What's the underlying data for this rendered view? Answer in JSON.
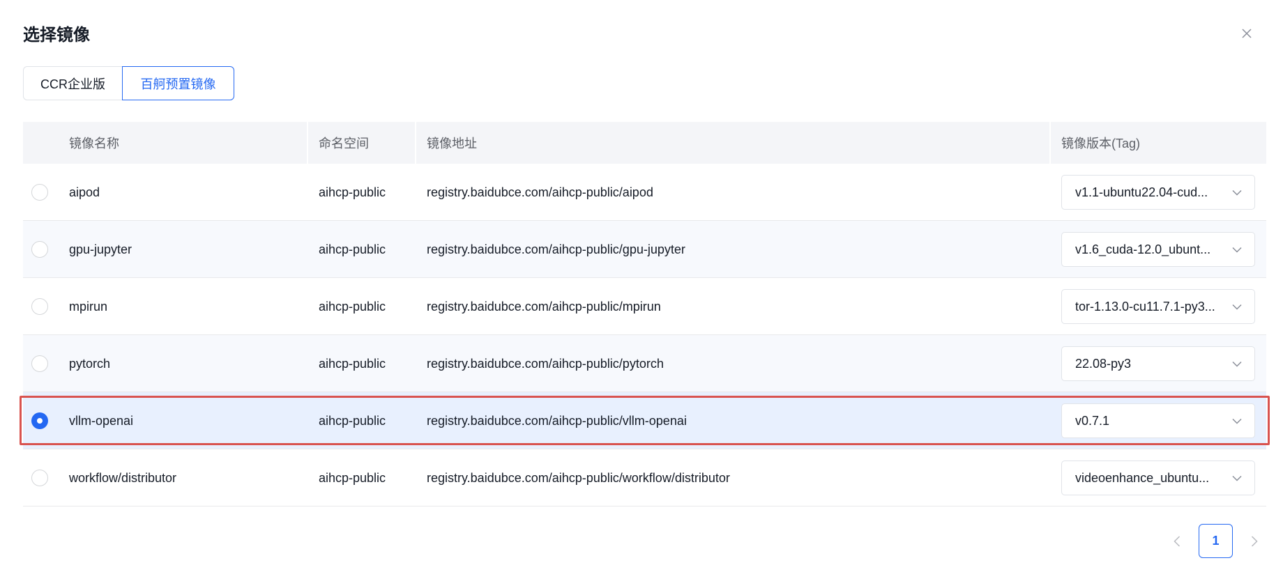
{
  "dialog": {
    "title": "选择镜像",
    "close_icon": "close-icon"
  },
  "tabs": [
    {
      "label": "CCR企业版",
      "active": false
    },
    {
      "label": "百舸预置镜像",
      "active": true
    }
  ],
  "table": {
    "columns": {
      "name": "镜像名称",
      "namespace": "命名空间",
      "address": "镜像地址",
      "tag": "镜像版本(Tag)"
    },
    "rows": [
      {
        "name": "aipod",
        "namespace": "aihcp-public",
        "address": "registry.baidubce.com/aihcp-public/aipod",
        "tag": "v1.1-ubuntu22.04-cud...",
        "selected": false
      },
      {
        "name": "gpu-jupyter",
        "namespace": "aihcp-public",
        "address": "registry.baidubce.com/aihcp-public/gpu-jupyter",
        "tag": "v1.6_cuda-12.0_ubunt...",
        "selected": false
      },
      {
        "name": "mpirun",
        "namespace": "aihcp-public",
        "address": "registry.baidubce.com/aihcp-public/mpirun",
        "tag": "tor-1.13.0-cu11.7.1-py3...",
        "selected": false
      },
      {
        "name": "pytorch",
        "namespace": "aihcp-public",
        "address": "registry.baidubce.com/aihcp-public/pytorch",
        "tag": "22.08-py3",
        "selected": false
      },
      {
        "name": "vllm-openai",
        "namespace": "aihcp-public",
        "address": "registry.baidubce.com/aihcp-public/vllm-openai",
        "tag": "v0.7.1",
        "selected": true
      },
      {
        "name": "workflow/distributor",
        "namespace": "aihcp-public",
        "address": "registry.baidubce.com/aihcp-public/workflow/distributor",
        "tag": "videoenhance_ubuntu...",
        "selected": false
      }
    ]
  },
  "pagination": {
    "current_page": "1",
    "prev_icon": "chevron-left-icon",
    "next_icon": "chevron-right-icon"
  },
  "colors": {
    "accent": "#2468f2",
    "selection_outline": "#d9534f",
    "header_bg": "#f4f5f8",
    "selected_row_bg": "#e8f0fe"
  }
}
